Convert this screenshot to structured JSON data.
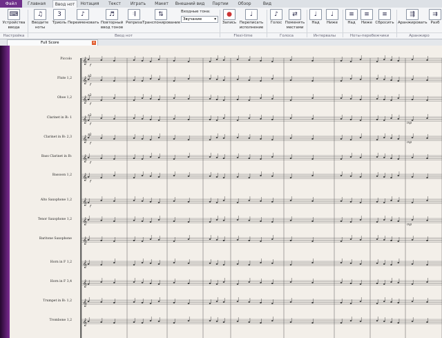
{
  "menu_tabs": [
    "Файл",
    "Главная",
    "Ввод нот",
    "Нотация",
    "Текст",
    "Играть",
    "Макет",
    "Внешний вид",
    "Партии",
    "Обзор",
    "Вид"
  ],
  "active_tab": "Ввод нот",
  "ribbon_buttons": [
    {
      "label": "Устройства ввода",
      "icon": "keyboard-icon"
    },
    {
      "label": "Вводите ноты",
      "icon": "notes-icon"
    },
    {
      "label": "Триоль",
      "icon": "triplet-icon"
    },
    {
      "label": "Переименовать",
      "icon": "rename-icon"
    },
    {
      "label": "Повторный ввод тонов",
      "icon": "repitch-icon"
    },
    {
      "label": "Реприза",
      "icon": "repeat-icon"
    },
    {
      "label": "Транспонирование",
      "icon": "transpose-icon"
    },
    {
      "label": "Запись",
      "icon": "record-icon"
    },
    {
      "label": "Переписать исполнение",
      "icon": "reinterpret-icon"
    },
    {
      "label": "Голос",
      "icon": "voice-icon"
    },
    {
      "label": "Поменять местами",
      "icon": "swap-icon"
    },
    {
      "label": "Над",
      "icon": "interval-above-icon"
    },
    {
      "label": "Ниже",
      "icon": "interval-below-icon"
    },
    {
      "label": "Над",
      "icon": "staff-above-icon"
    },
    {
      "label": "Ниже",
      "icon": "staff-below-icon"
    },
    {
      "label": "Сбросить",
      "icon": "reset-icon"
    },
    {
      "label": "Аранжировать",
      "icon": "arrange-icon"
    },
    {
      "label": "Разб",
      "icon": "explode-icon"
    }
  ],
  "input_pitch": {
    "label": "Входные тона:",
    "value": "Звучание"
  },
  "ribbon_groups": [
    "Настройка",
    "Ввод нот",
    "Flexi-time",
    "Голоса",
    "Интервалы",
    "Ноты-перебежчики",
    "Аранжиро"
  ],
  "document_tab": {
    "title": "Full Score",
    "close": "×"
  },
  "instruments": [
    "Piccolo",
    "Flute 1,2",
    "Oboe 1,2",
    "Clarinet in B♭ 1",
    "Clarinet in B♭ 2,3",
    "Bass Clarinet in B♭",
    "Bassoon 1,2",
    "Alto Saxophone 1,2",
    "Tenor Saxophone 1,2",
    "Baritone Saxophone",
    "Horn in F 1,2",
    "Horn in F 3,4",
    "Trumpet in B♭ 1,2",
    "Trombone 1,2"
  ],
  "dynamics": {
    "f": "f",
    "mp": "mp",
    "p": "p",
    "a2": "a2"
  },
  "colors": {
    "file_tab": "#6e2f8a",
    "paper": "#f3efe9",
    "sidebar": "#7b2b93",
    "close": "#e05a2b"
  }
}
